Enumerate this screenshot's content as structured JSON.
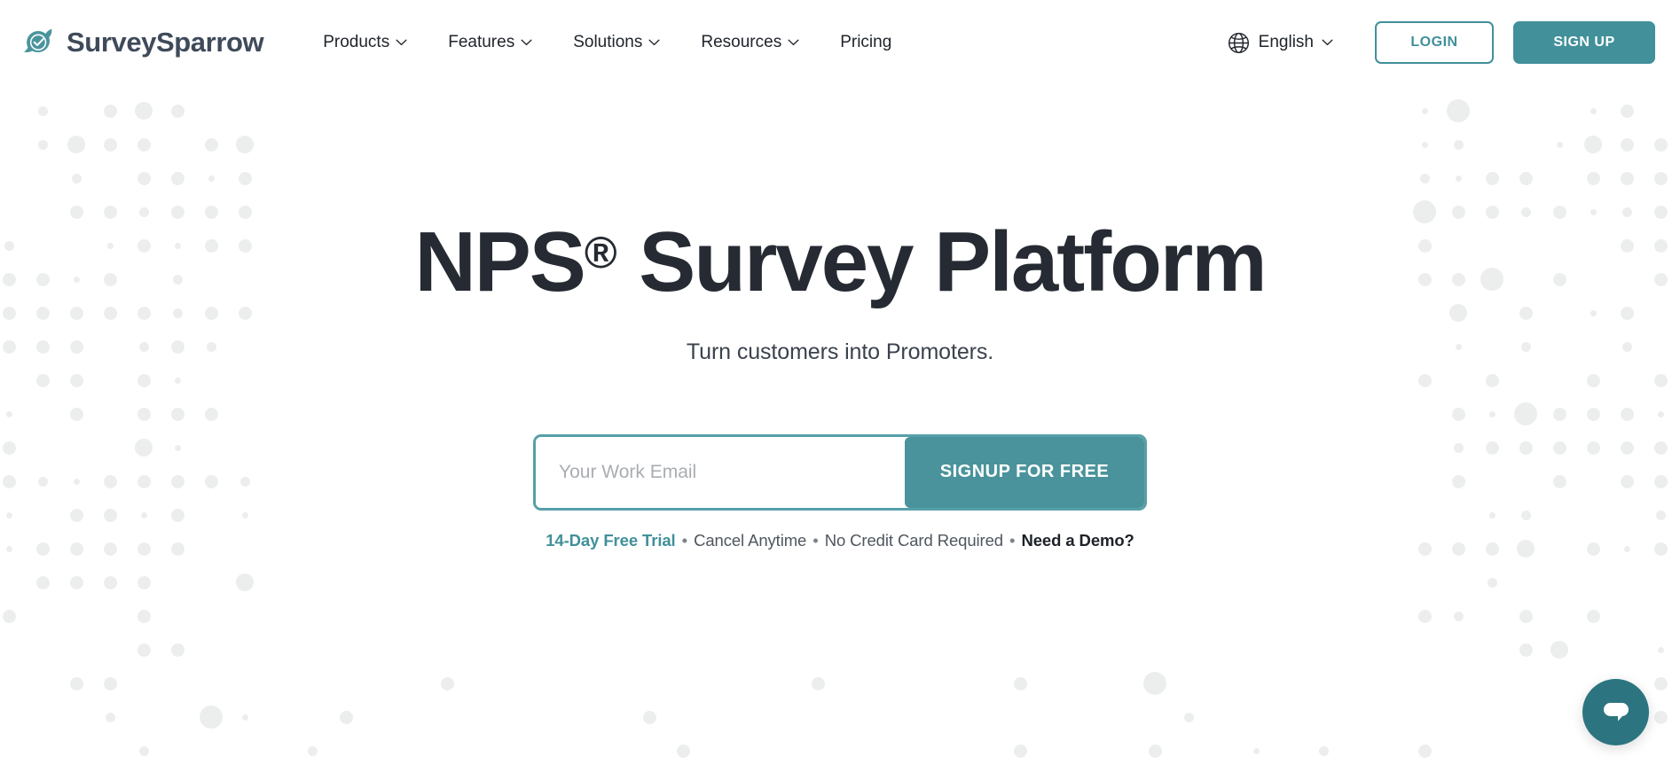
{
  "brand": {
    "name": "SurveySparrow",
    "logo_icon": "sparrow-check-logo",
    "color": "#41909a"
  },
  "nav": {
    "items": [
      {
        "label": "Products",
        "has_dropdown": true,
        "icon": "chevron-down-icon"
      },
      {
        "label": "Features",
        "has_dropdown": true,
        "icon": "chevron-down-icon"
      },
      {
        "label": "Solutions",
        "has_dropdown": true,
        "icon": "chevron-down-icon"
      },
      {
        "label": "Resources",
        "has_dropdown": true,
        "icon": "chevron-down-icon"
      },
      {
        "label": "Pricing",
        "has_dropdown": false,
        "icon": ""
      }
    ]
  },
  "header_right": {
    "language": {
      "icon": "globe-icon",
      "label": "English",
      "chevron": "chevron-down-icon"
    },
    "login_label": "LOGIN",
    "signup_label": "SIGN UP"
  },
  "hero": {
    "title_main": "NPS",
    "title_registered": "®",
    "title_rest": " Survey Platform",
    "subtitle": "Turn customers into Promoters."
  },
  "signup": {
    "email_placeholder": "Your Work Email",
    "email_value": "",
    "button_label": "SIGNUP FOR FREE"
  },
  "trial_note": {
    "highlight": "14-Day Free Trial",
    "sep1": " • ",
    "text1": "Cancel Anytime",
    "sep2": " • ",
    "text2": "No Credit Card Required",
    "sep3": " • ",
    "demo_link": "Need a Demo?",
    "highlight_color": "#41909a"
  },
  "chat": {
    "icon": "chat-bubble-icon",
    "color": "#2c7580"
  },
  "colors": {
    "accent_teal": "#41909a",
    "dark_slate": "#262b33",
    "dot_gray": "#eceeee",
    "page_bg": "#ffffff"
  }
}
